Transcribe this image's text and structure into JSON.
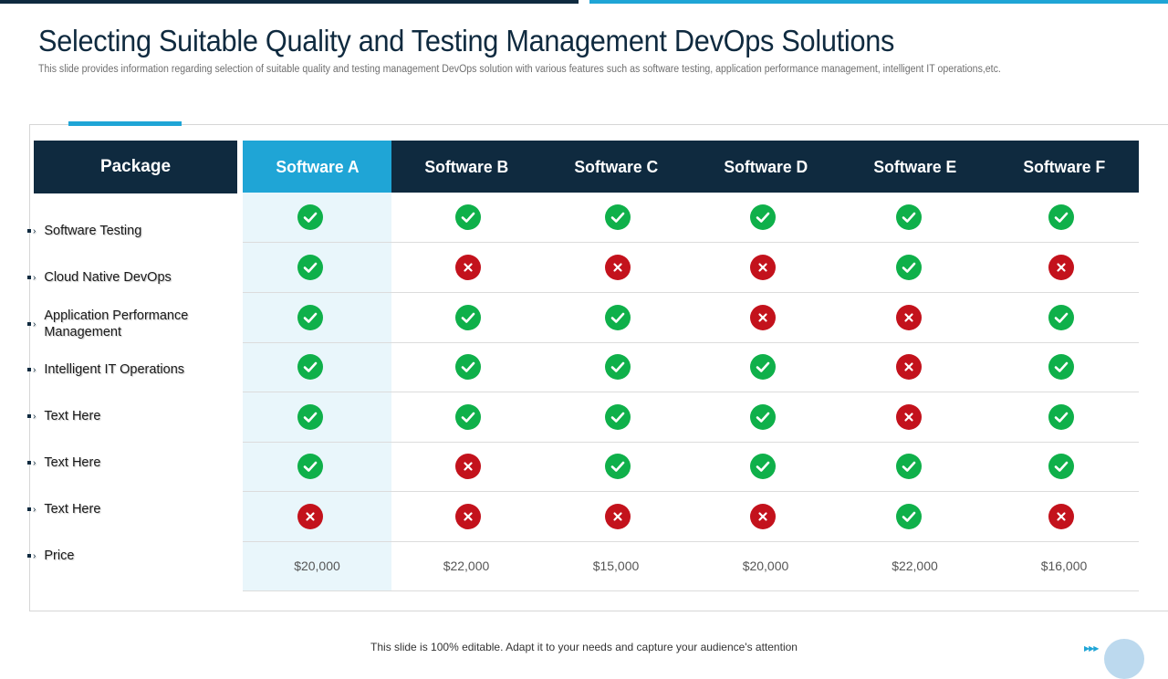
{
  "slide": {
    "title": "Selecting Suitable Quality and Testing Management DevOps Solutions",
    "subtitle": "This slide provides information regarding selection of suitable quality and testing management DevOps solution with various features such as software testing, application performance management, intelligent IT operations,etc."
  },
  "table": {
    "package_header": "Package",
    "software": [
      "Software A",
      "Software B",
      "Software C",
      "Software D",
      "Software E",
      "Software F"
    ],
    "features": [
      "Software Testing",
      "Cloud Native DevOps",
      "Application Performance Management",
      "Intelligent IT Operations",
      "Text Here",
      "Text Here",
      "Text Here",
      "Price"
    ],
    "matrix": [
      [
        "yes",
        "yes",
        "yes",
        "yes",
        "yes",
        "yes"
      ],
      [
        "yes",
        "no",
        "no",
        "no",
        "yes",
        "no"
      ],
      [
        "yes",
        "yes",
        "yes",
        "no",
        "no",
        "yes"
      ],
      [
        "yes",
        "yes",
        "yes",
        "yes",
        "no",
        "yes"
      ],
      [
        "yes",
        "yes",
        "yes",
        "yes",
        "no",
        "yes"
      ],
      [
        "yes",
        "no",
        "yes",
        "yes",
        "yes",
        "yes"
      ],
      [
        "no",
        "no",
        "no",
        "no",
        "yes",
        "no"
      ]
    ],
    "prices": [
      "$20,000",
      "$22,000",
      "$15,000",
      "$20,000",
      "$22,000",
      "$16,000"
    ]
  },
  "footer": {
    "note": "This slide is 100% editable. Adapt it to your needs and capture your audience's attention"
  },
  "colors": {
    "navy": "#0f2a3f",
    "accent": "#1fa5d6",
    "check": "#0fb04a",
    "cross": "#c3121c"
  },
  "icons": {
    "yes": "check-circle-icon",
    "no": "cross-circle-icon"
  }
}
